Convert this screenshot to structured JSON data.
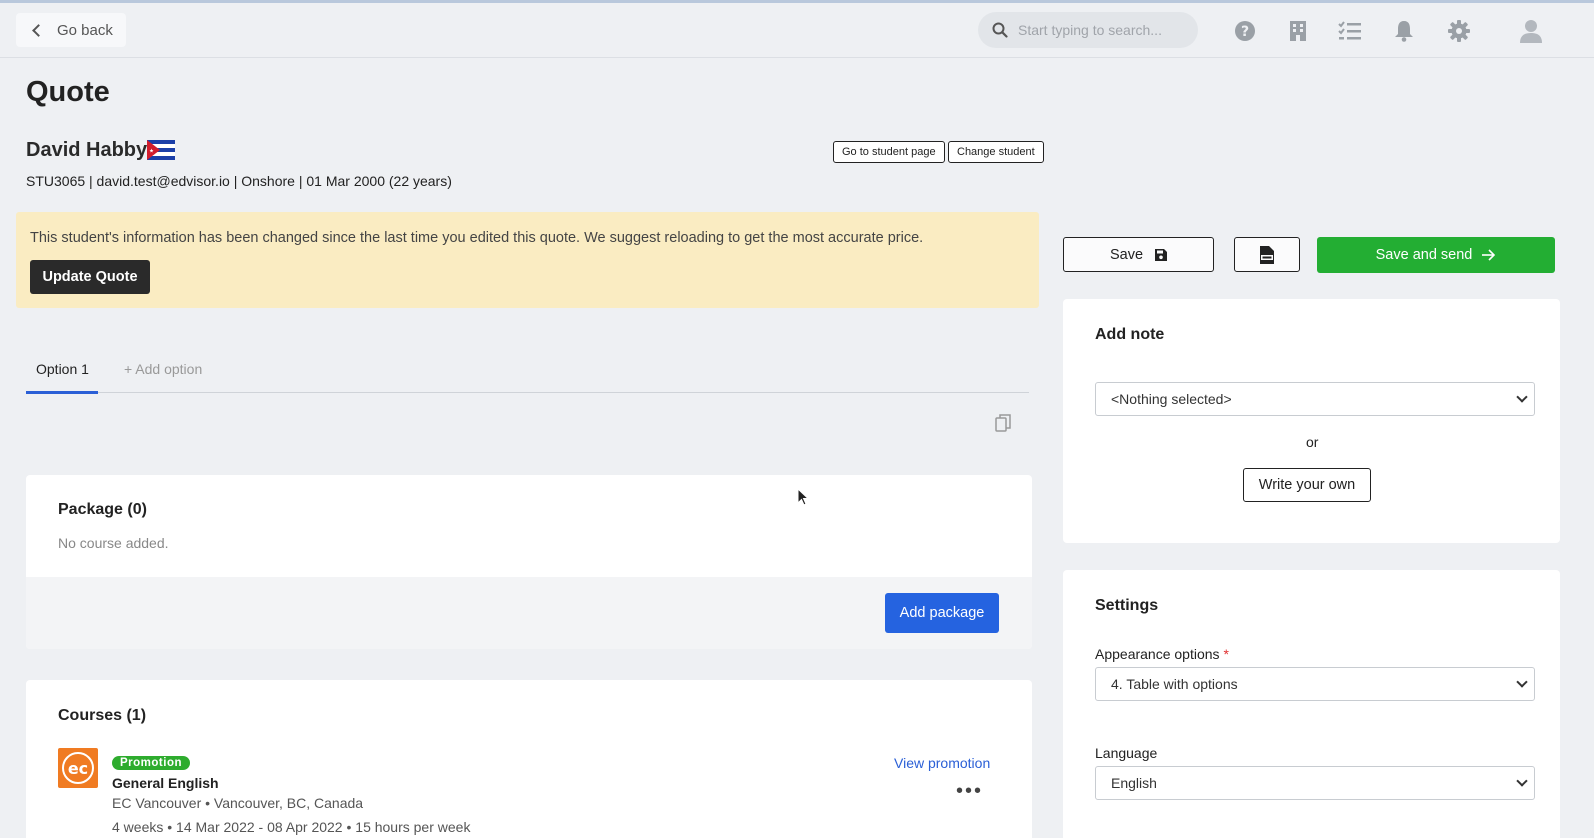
{
  "topbar": {
    "go_back_label": "Go back",
    "search_placeholder": "Start typing to search..."
  },
  "page": {
    "title": "Quote"
  },
  "student": {
    "name": "David Habby",
    "flag": "cuba-flag",
    "meta": "STU3065 | david.test@edvisor.io | Onshore | 01 Mar 2000 (22 years)",
    "go_to_student_label": "Go to student page",
    "change_student_label": "Change student"
  },
  "alert": {
    "message": "This student's information has been changed since the last time you edited this quote. We suggest reloading to get the most accurate price.",
    "button_label": "Update Quote"
  },
  "tabs": [
    {
      "label": "Option 1",
      "active": true
    },
    {
      "label": "+ Add option",
      "active": false
    }
  ],
  "package": {
    "title": "Package (0)",
    "empty_text": "No course added.",
    "add_label": "Add package"
  },
  "courses": {
    "title": "Courses (1)",
    "items": [
      {
        "badge": "Promotion",
        "name": "General English",
        "location": "EC Vancouver • Vancouver, BC, Canada",
        "dates": "4 weeks • 14 Mar 2022 - 08 Apr 2022 • 15 hours per week",
        "view_promotion_label": "View promotion"
      }
    ]
  },
  "actions": {
    "save_label": "Save",
    "save_send_label": "Save and send"
  },
  "note": {
    "title": "Add note",
    "select_value": "<Nothing selected>",
    "or_text": "or",
    "write_own_label": "Write your own"
  },
  "settings": {
    "title": "Settings",
    "appearance_label": "Appearance options",
    "required_mark": "*",
    "appearance_value": "4. Table with options",
    "language_label": "Language",
    "language_value": "English"
  },
  "colors": {
    "primary_blue": "#2563e0",
    "success_green": "#23ae33",
    "alert_bg": "#faecc2",
    "promo_green": "#2eac2e",
    "brand_orange": "#f07b22"
  }
}
